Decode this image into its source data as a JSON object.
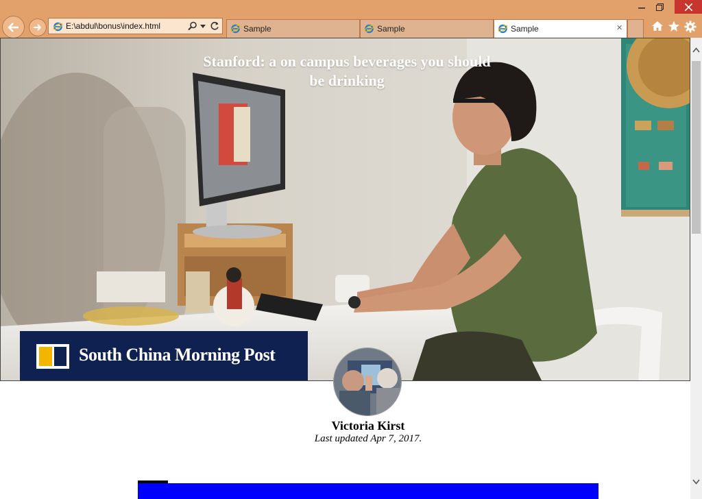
{
  "browser": {
    "address_url": "E:\\abdul\\bonus\\index.html",
    "tabs": [
      {
        "label": "Sample",
        "active": false
      },
      {
        "label": "Sample",
        "active": false
      },
      {
        "label": "Sample",
        "active": true
      }
    ],
    "tab_close_glyph": "×",
    "window_buttons": [
      "minimize-icon",
      "restore-icon",
      "close-icon"
    ],
    "toolbar_icons": [
      "home-icon",
      "favorites-star-icon",
      "settings-gear-icon"
    ],
    "chrome_color": "#e2a06a"
  },
  "article": {
    "title": "Stanford: a on campus beverages you should be drinking",
    "brand_name": "South China Morning Post",
    "author": "Victoria Kirst",
    "updated": "Last updated Apr 7, 2017.",
    "accent_color": "#0000ff",
    "brand_color": "#0f2150"
  }
}
